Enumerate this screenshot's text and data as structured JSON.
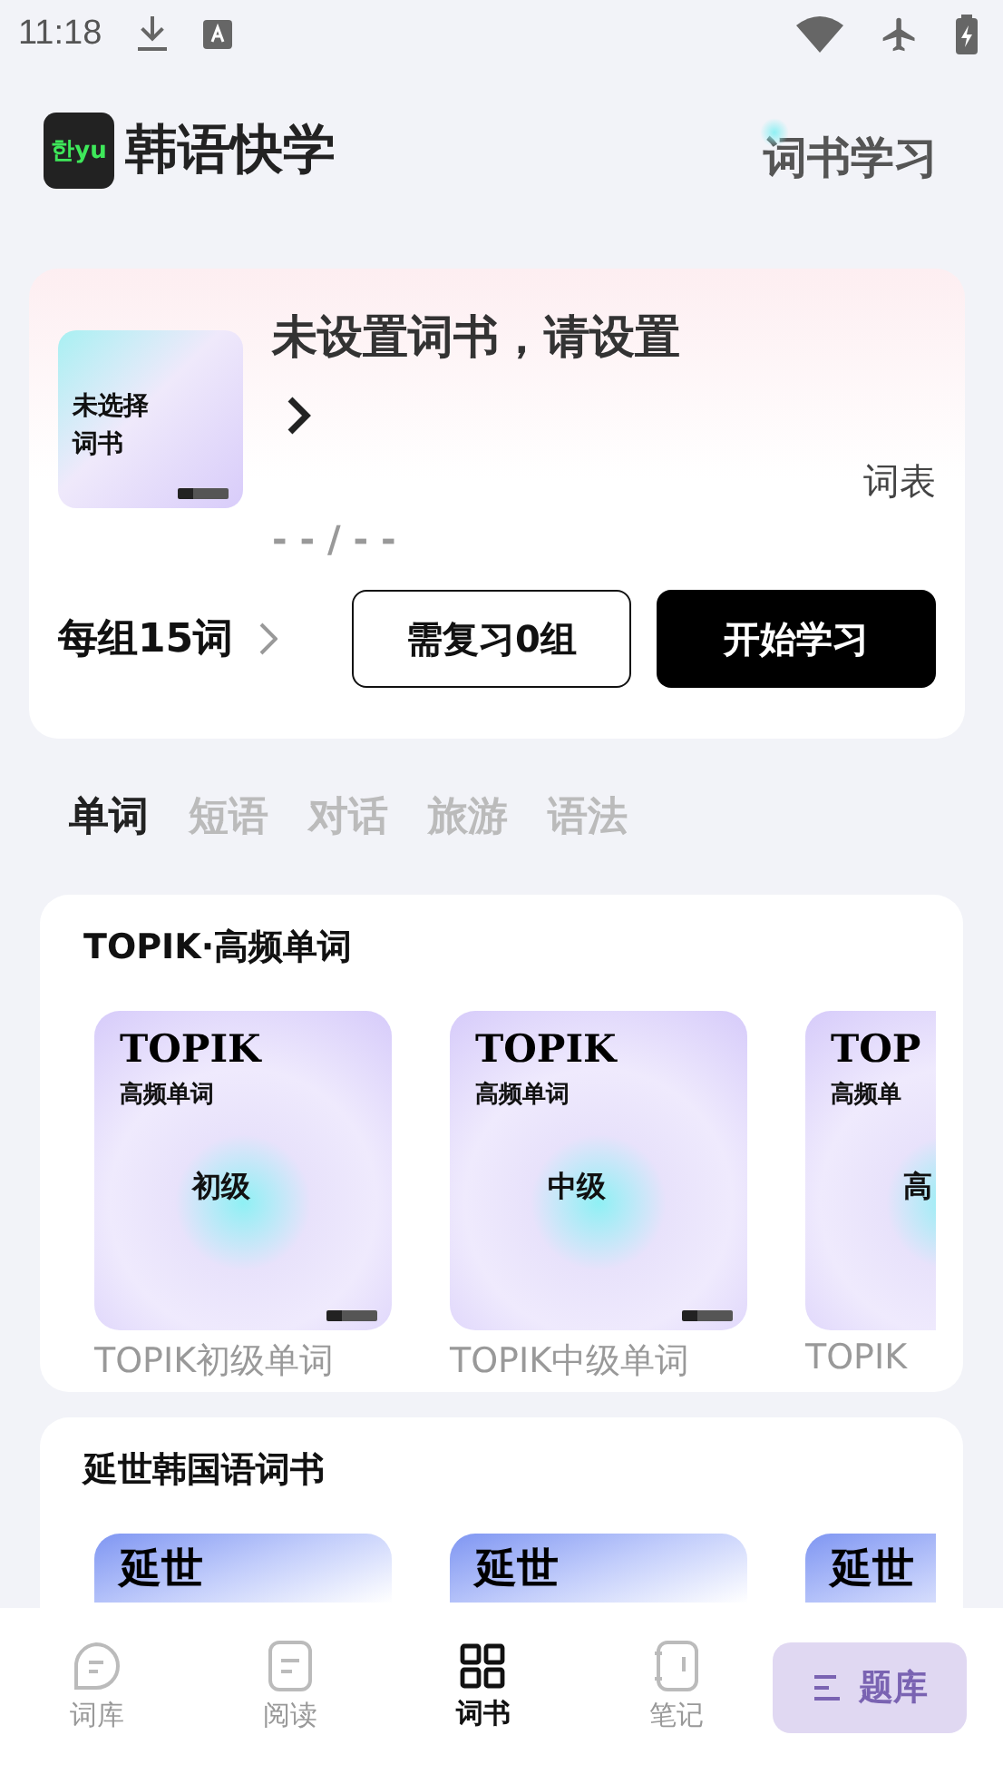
{
  "status_bar": {
    "time": "11:18"
  },
  "header": {
    "logo_mark": "한yu",
    "app_name": "韩语快学",
    "action": "词书学习"
  },
  "current_book": {
    "cover_text": "未选择",
    "cover_text_2": "词书",
    "title": "未设置词书，请设置",
    "progress": "- - / - -",
    "wordlist_link": "词表",
    "per_group": "每组15词",
    "review_button": "需复习0组",
    "start_button": "开始学习"
  },
  "tabs": [
    {
      "label": "单词",
      "selected": true
    },
    {
      "label": "短语",
      "selected": false
    },
    {
      "label": "对话",
      "selected": false
    },
    {
      "label": "旅游",
      "selected": false
    },
    {
      "label": "语法",
      "selected": false
    }
  ],
  "sections": [
    {
      "title": "TOPIK·高频单词",
      "kind": "topik",
      "books": [
        {
          "cover_title": "TOPIK",
          "cover_subtitle": "高频单词",
          "level": "初级",
          "label": "TOPIK初级单词"
        },
        {
          "cover_title": "TOPIK",
          "cover_subtitle": "高频单词",
          "level": "中级",
          "label": "TOPIK中级单词"
        },
        {
          "cover_title": "TOP",
          "cover_subtitle": "高频单",
          "level": "高",
          "label": "TOPIK"
        }
      ]
    },
    {
      "title": "延世韩国语词书",
      "kind": "yonsei",
      "books": [
        {
          "cover_title": "延世"
        },
        {
          "cover_title": "延世"
        },
        {
          "cover_title": "延世"
        }
      ]
    }
  ],
  "bottom_nav": [
    {
      "label": "词库",
      "selected": false
    },
    {
      "label": "阅读",
      "selected": false
    },
    {
      "label": "词书",
      "selected": true
    },
    {
      "label": "笔记",
      "selected": false
    }
  ],
  "quiz_button": "题库"
}
